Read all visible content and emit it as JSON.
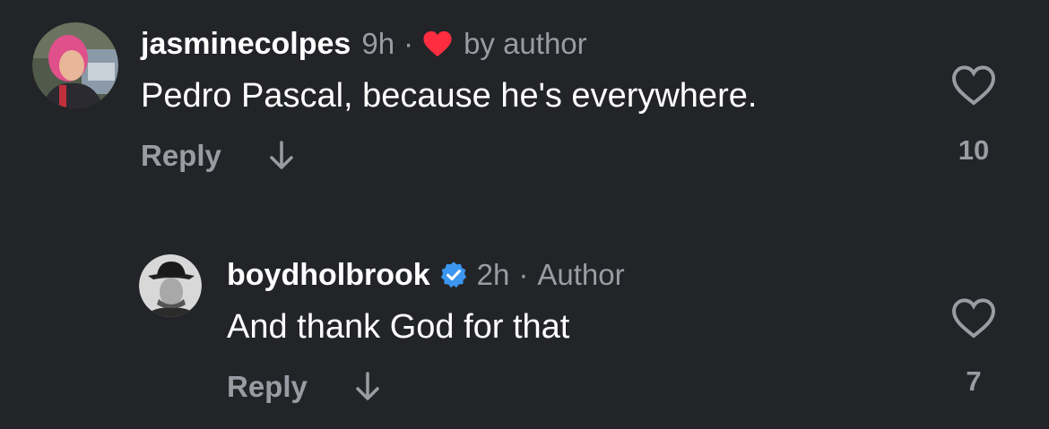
{
  "comments": [
    {
      "username": "jasminecolpes",
      "time": "9h",
      "separator": "·",
      "liked_by": "by author",
      "text": "Pedro Pascal, because he's everywhere.",
      "reply_label": "Reply",
      "like_count": "10",
      "heart_color": "#ff2d3f"
    },
    {
      "username": "boydholbrook",
      "verified": true,
      "time": "2h",
      "separator": "·",
      "badge": "Author",
      "text": "And thank God for that",
      "reply_label": "Reply",
      "like_count": "7",
      "verified_color": "#3b96f0"
    }
  ],
  "colors": {
    "background": "#232428",
    "secondary_text": "#9a9ca3",
    "primary_text": "#ffffff"
  }
}
